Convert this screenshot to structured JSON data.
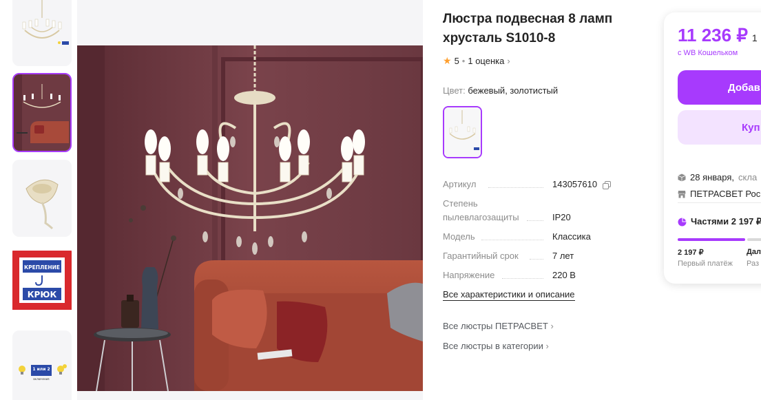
{
  "product": {
    "title": "Люстра подвесная 8 ламп хрусталь S1010-8",
    "rating": "5",
    "reviews": "1 оценка",
    "color_label": "Цвет:",
    "color_value": "бежевый, золотистый"
  },
  "thumbnails": {
    "hook_text_1": "КРЕПЛЕНИЕ",
    "hook_text_2": "КРЮК",
    "switch_text": "1 или 2",
    "switch_sub": "включения"
  },
  "specs": [
    {
      "name": "Артикул",
      "value": "143057610"
    },
    {
      "name": "Степень пылевлагозащиты",
      "value": "IP20"
    },
    {
      "name": "Модель",
      "value": "Классика"
    },
    {
      "name": "Гарантийный срок",
      "value": "7 лет"
    },
    {
      "name": "Напряжение",
      "value": "220 В"
    }
  ],
  "links": {
    "all_chars": "Все характеристики и описание",
    "all_brand": "Все люстры ПЕТРАСВЕТ",
    "all_category": "Все люстры в категории"
  },
  "card": {
    "price": "11 236 ₽",
    "price_old": "1",
    "wallet": "с WB Кошельком",
    "add_button": "Добав",
    "buy_button": "Куп",
    "delivery_date": "28 января,",
    "delivery_where": "скла",
    "seller": "ПЕТРАСВЕТ Рос",
    "parts": "Частями 2 197 ₽",
    "first_amount": "2 197 ₽",
    "first_label": "Первый платёж",
    "next_amount": "Дал",
    "next_label": "Раз"
  },
  "colors": {
    "accent": "#a73afd",
    "accent_light": "#f3e3ff",
    "star": "#ff9f2e",
    "wall": "#6e3a42",
    "sofa": "#a84a3a"
  }
}
